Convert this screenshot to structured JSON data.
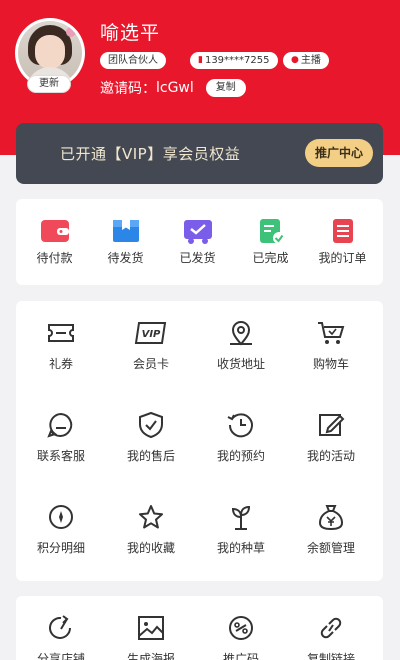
{
  "profile": {
    "name": "喻选平",
    "update_label": "更新",
    "tags": {
      "team": "团队合伙人",
      "phone": "139****7255",
      "role": "主播"
    },
    "invite_label": "邀请码：",
    "invite_code": "lcGwl",
    "copy_label": "复制"
  },
  "vip": {
    "text": "已开通【VIP】享会员权益",
    "promo_label": "推广中心"
  },
  "orders": [
    {
      "label": "待付款",
      "icon": "wallet-icon",
      "color": "#f04a5a"
    },
    {
      "label": "待发货",
      "icon": "package-icon",
      "color": "#2c86e8"
    },
    {
      "label": "已发货",
      "icon": "truck-icon",
      "color": "#7a5de8"
    },
    {
      "label": "已完成",
      "icon": "check-doc-icon",
      "color": "#3ec27a"
    },
    {
      "label": "我的订单",
      "icon": "order-list-icon",
      "color": "#e84350"
    }
  ],
  "services": [
    {
      "label": "礼券",
      "icon": "coupon-icon"
    },
    {
      "label": "会员卡",
      "icon": "vip-card-icon",
      "icon_text": "VIP"
    },
    {
      "label": "收货地址",
      "icon": "location-pin-icon"
    },
    {
      "label": "购物车",
      "icon": "cart-icon"
    },
    {
      "label": "联系客服",
      "icon": "chat-icon"
    },
    {
      "label": "我的售后",
      "icon": "shield-icon"
    },
    {
      "label": "我的预约",
      "icon": "clock-icon"
    },
    {
      "label": "我的活动",
      "icon": "edit-icon"
    },
    {
      "label": "积分明细",
      "icon": "points-icon"
    },
    {
      "label": "我的收藏",
      "icon": "star-icon"
    },
    {
      "label": "我的种草",
      "icon": "sprout-icon"
    },
    {
      "label": "余额管理",
      "icon": "money-bag-icon"
    }
  ],
  "tools": [
    {
      "label": "分享店铺",
      "icon": "share-icon"
    },
    {
      "label": "生成海报",
      "icon": "image-icon"
    },
    {
      "label": "推广码",
      "icon": "promo-code-icon"
    },
    {
      "label": "复制链接",
      "icon": "link-icon"
    }
  ]
}
